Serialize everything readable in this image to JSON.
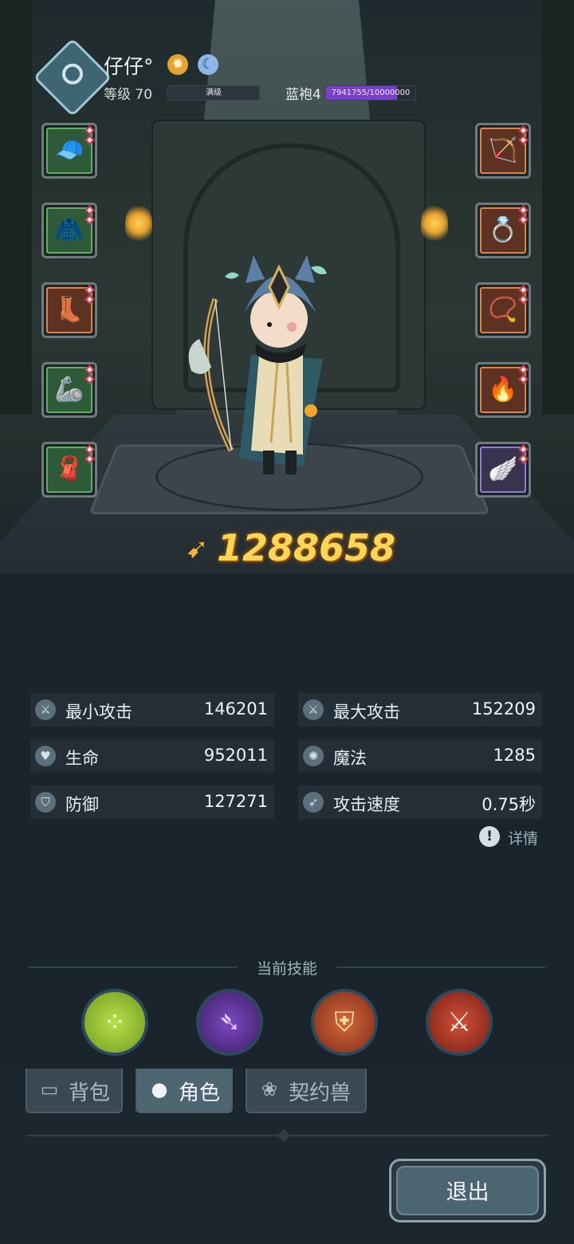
{
  "header": {
    "player_name": "仔仔°",
    "level_label": "等级 70",
    "level_bar_text": "满级",
    "rank_label": "蓝袍4",
    "xp_text": "7941755/10000000",
    "xp_fraction": 0.794
  },
  "equipment": {
    "left": [
      {
        "name": "hood-icon",
        "glyph": "🧢",
        "rarity": "green"
      },
      {
        "name": "armor-icon",
        "glyph": "🧥",
        "rarity": "green"
      },
      {
        "name": "boots-icon",
        "glyph": "👢",
        "rarity": "orange"
      },
      {
        "name": "bracer-icon",
        "glyph": "🦾",
        "rarity": "green"
      },
      {
        "name": "cloak-icon",
        "glyph": "🧣",
        "rarity": "green"
      }
    ],
    "right": [
      {
        "name": "bow-icon",
        "glyph": "🏹",
        "rarity": "orange"
      },
      {
        "name": "ring-icon",
        "glyph": "💍",
        "rarity": "orange"
      },
      {
        "name": "necklace-icon",
        "glyph": "📿",
        "rarity": "orange"
      },
      {
        "name": "emblem-icon",
        "glyph": "🔥",
        "rarity": "orange"
      },
      {
        "name": "wings-icon",
        "glyph": "🪽",
        "rarity": "purple"
      }
    ]
  },
  "power": {
    "value": "1288658"
  },
  "stats": [
    {
      "label": "最小攻击",
      "value": "146201",
      "icon": "sword-icon"
    },
    {
      "label": "最大攻击",
      "value": "152209",
      "icon": "sword-icon"
    },
    {
      "label": "生命",
      "value": "952011",
      "icon": "heart-icon"
    },
    {
      "label": "魔法",
      "value": "1285",
      "icon": "magic-orb-icon"
    },
    {
      "label": "防御",
      "value": "127271",
      "icon": "shield-icon"
    },
    {
      "label": "攻击速度",
      "value": "0.75秒",
      "icon": "speed-icon"
    }
  ],
  "detail_label": "详情",
  "skills": {
    "title": "当前技能",
    "items": [
      {
        "name": "poison-orbs-skill",
        "bg": "#8fbf2c"
      },
      {
        "name": "arcane-arrow-skill",
        "bg": "#5b2f8f"
      },
      {
        "name": "shield-crown-skill",
        "bg": "#b04a2a"
      },
      {
        "name": "crossed-axes-skill",
        "bg": "#b13a24"
      }
    ]
  },
  "tabs": [
    {
      "label": "背包",
      "icon": "backpack-icon",
      "active": false
    },
    {
      "label": "角色",
      "icon": "character-icon",
      "active": true
    },
    {
      "label": "契约兽",
      "icon": "paw-icon",
      "active": false
    }
  ],
  "exit_label": "退出",
  "colors": {
    "background": "#1a242c",
    "power": "#ffd556",
    "xp_fill": "#7a3fcf"
  }
}
